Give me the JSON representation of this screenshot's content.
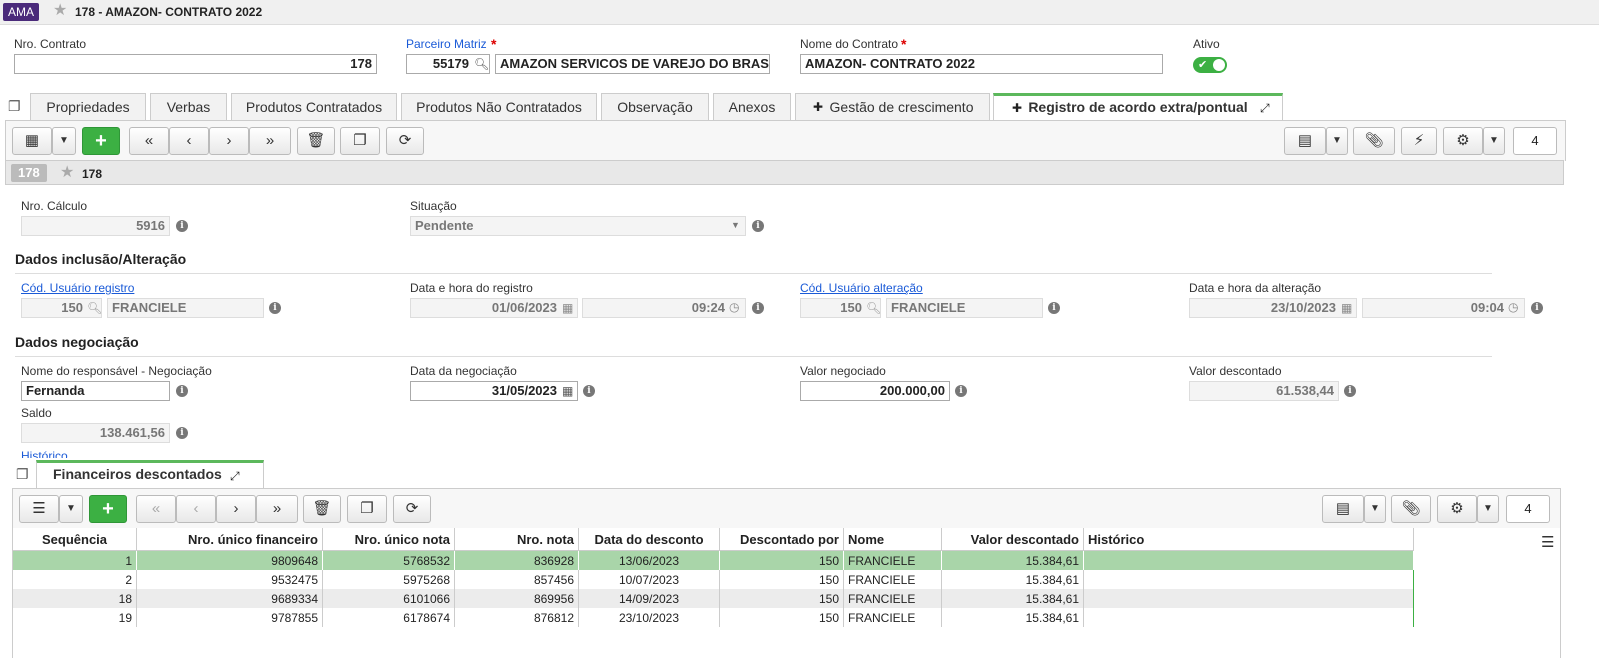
{
  "header": {
    "app_badge": "AMA",
    "title": "178 - AMAZON- CONTRATO 2022"
  },
  "form": {
    "nro_contrato": {
      "label": "Nro. Contrato",
      "value": "178"
    },
    "parceiro": {
      "label": "Parceiro Matriz",
      "code": "55179",
      "name": "AMAZON SERVICOS DE VAREJO DO BRASI"
    },
    "nome_contrato": {
      "label": "Nome do Contrato",
      "value": "AMAZON- CONTRATO 2022"
    },
    "ativo": {
      "label": "Ativo",
      "value": true
    }
  },
  "tabs": [
    {
      "label": "Propriedades"
    },
    {
      "label": "Verbas"
    },
    {
      "label": "Produtos Contratados"
    },
    {
      "label": "Produtos Não Contratados"
    },
    {
      "label": "Observação"
    },
    {
      "label": "Anexos"
    },
    {
      "label": "Gestão de crescimento"
    },
    {
      "label": "Registro de acordo extra/pontual"
    }
  ],
  "toolbar": {
    "record_count": "4"
  },
  "record": {
    "badge": "178",
    "name": "178"
  },
  "detail": {
    "nro_calculo": {
      "label": "Nro. Cálculo",
      "value": "5916"
    },
    "situacao": {
      "label": "Situação",
      "value": "Pendente"
    },
    "section1": "Dados inclusão/Alteração",
    "cod_usuario_registro": {
      "label": "Cód. Usuário registro",
      "code": "150",
      "name": "FRANCIELE"
    },
    "data_registro": {
      "label": "Data e hora do registro",
      "date": "01/06/2023",
      "time": "09:24"
    },
    "cod_usuario_alteracao": {
      "label": "Cód. Usuário alteração",
      "code": "150",
      "name": "FRANCIELE"
    },
    "data_alteracao": {
      "label": "Data e hora da alteração",
      "date": "23/10/2023",
      "time": "09:04"
    },
    "section2": "Dados negociação",
    "responsavel": {
      "label": "Nome do responsável - Negociação",
      "value": "Fernanda"
    },
    "data_negociacao": {
      "label": "Data da negociação",
      "value": "31/05/2023"
    },
    "valor_negociado": {
      "label": "Valor negociado",
      "value": "200.000,00"
    },
    "valor_descontado": {
      "label": "Valor descontado",
      "value": "61.538,44"
    },
    "saldo": {
      "label": "Saldo",
      "value": "138.461,56"
    },
    "historico_label": "Histórico"
  },
  "subtab": {
    "label": "Financeiros descontados",
    "record_count": "4"
  },
  "grid": {
    "columns": [
      "Sequência",
      "Nro. único financeiro",
      "Nro. único nota",
      "Nro. nota",
      "Data do desconto",
      "Descontado por",
      "Nome",
      "Valor descontado",
      "Histórico"
    ],
    "rows": [
      [
        "1",
        "9809648",
        "5768532",
        "836928",
        "13/06/2023",
        "150",
        "FRANCIELE",
        "15.384,61",
        ""
      ],
      [
        "2",
        "9532475",
        "5975268",
        "857456",
        "10/07/2023",
        "150",
        "FRANCIELE",
        "15.384,61",
        ""
      ],
      [
        "18",
        "9689334",
        "6101066",
        "869956",
        "14/09/2023",
        "150",
        "FRANCIELE",
        "15.384,61",
        ""
      ],
      [
        "19",
        "9787855",
        "6178674",
        "876812",
        "23/10/2023",
        "150",
        "FRANCIELE",
        "15.384,61",
        ""
      ]
    ]
  }
}
